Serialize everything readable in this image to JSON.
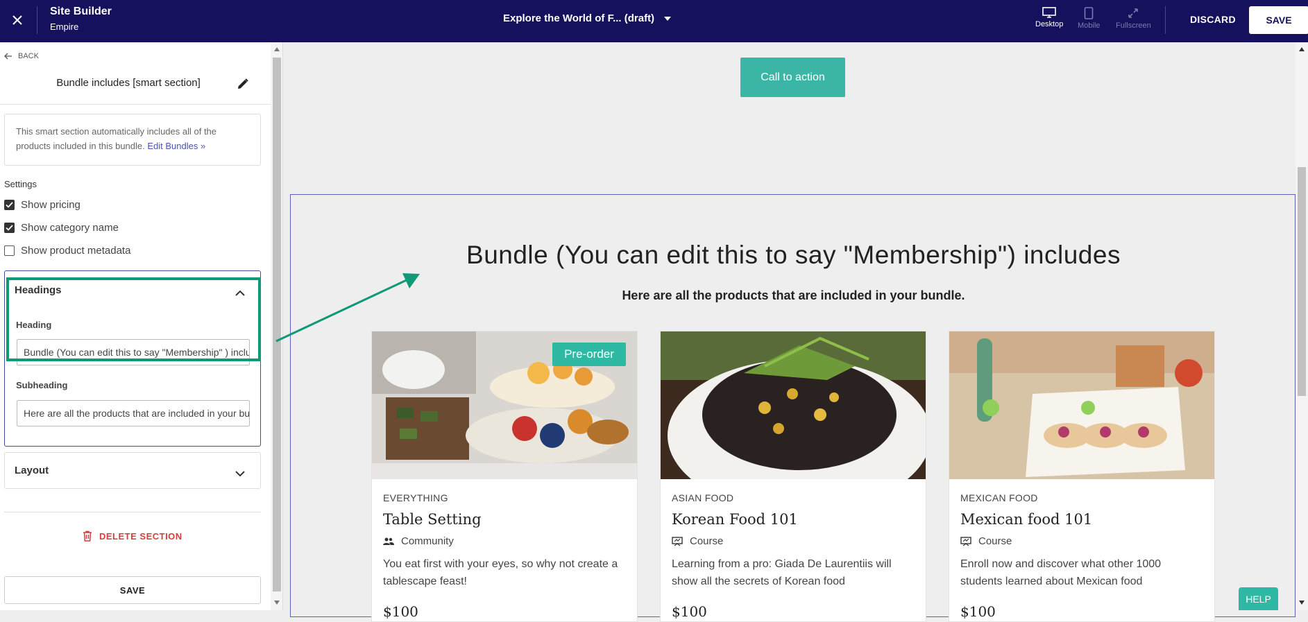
{
  "topbar": {
    "app_name": "Site Builder",
    "site_name": "Empire",
    "page_title": "Explore the World of F... (draft)",
    "devices": [
      {
        "label": "Desktop",
        "active": true
      },
      {
        "label": "Mobile",
        "active": false
      },
      {
        "label": "Fullscreen",
        "active": false
      }
    ],
    "discard_label": "DISCARD",
    "save_label": "SAVE"
  },
  "sidebar": {
    "back_label": "BACK",
    "section_title": "Bundle includes [smart section]",
    "info_text": "This smart section automatically includes all of the products included in this bundle.",
    "info_link": "Edit Bundles »",
    "settings_label": "Settings",
    "checkboxes": [
      {
        "label": "Show pricing",
        "checked": true
      },
      {
        "label": "Show category name",
        "checked": true
      },
      {
        "label": "Show product metadata",
        "checked": false
      }
    ],
    "headings_panel": {
      "title": "Headings",
      "heading_label": "Heading",
      "heading_value": "Bundle (You can edit this to say \"Membership\" ) includes",
      "subheading_label": "Subheading",
      "subheading_value": "Here are all the products that are included in your bundle."
    },
    "layout_panel_title": "Layout",
    "delete_label": "DELETE SECTION",
    "save_label": "SAVE"
  },
  "canvas": {
    "cta_label": "Call to action",
    "bundle_heading": "Bundle (You can edit this to say \"Membership\") includes",
    "bundle_subheading": "Here are all the products that are included in your bundle.",
    "products": [
      {
        "category": "EVERYTHING",
        "name": "Table Setting",
        "type": "Community",
        "description": "You eat first with your eyes, so why not create a tablescape feast!",
        "price": "$100",
        "badge": "Pre-order"
      },
      {
        "category": "ASIAN FOOD",
        "name": "Korean Food 101",
        "type": "Course",
        "description": "Learning from a pro: Giada De Laurentiis will show all the secrets of Korean food",
        "price": "$100"
      },
      {
        "category": "MEXICAN FOOD",
        "name": "Mexican food 101",
        "type": "Course",
        "description": "Enroll now and discover what other 1000 students learned about Mexican food",
        "price": "$100"
      }
    ],
    "help_label": "HELP"
  },
  "colors": {
    "topbar_bg": "#15115d",
    "accent_teal": "#3bb5a6",
    "highlight_green": "#0f9978",
    "delete_red": "#d33f3f",
    "selection_blue": "#5962b9"
  }
}
